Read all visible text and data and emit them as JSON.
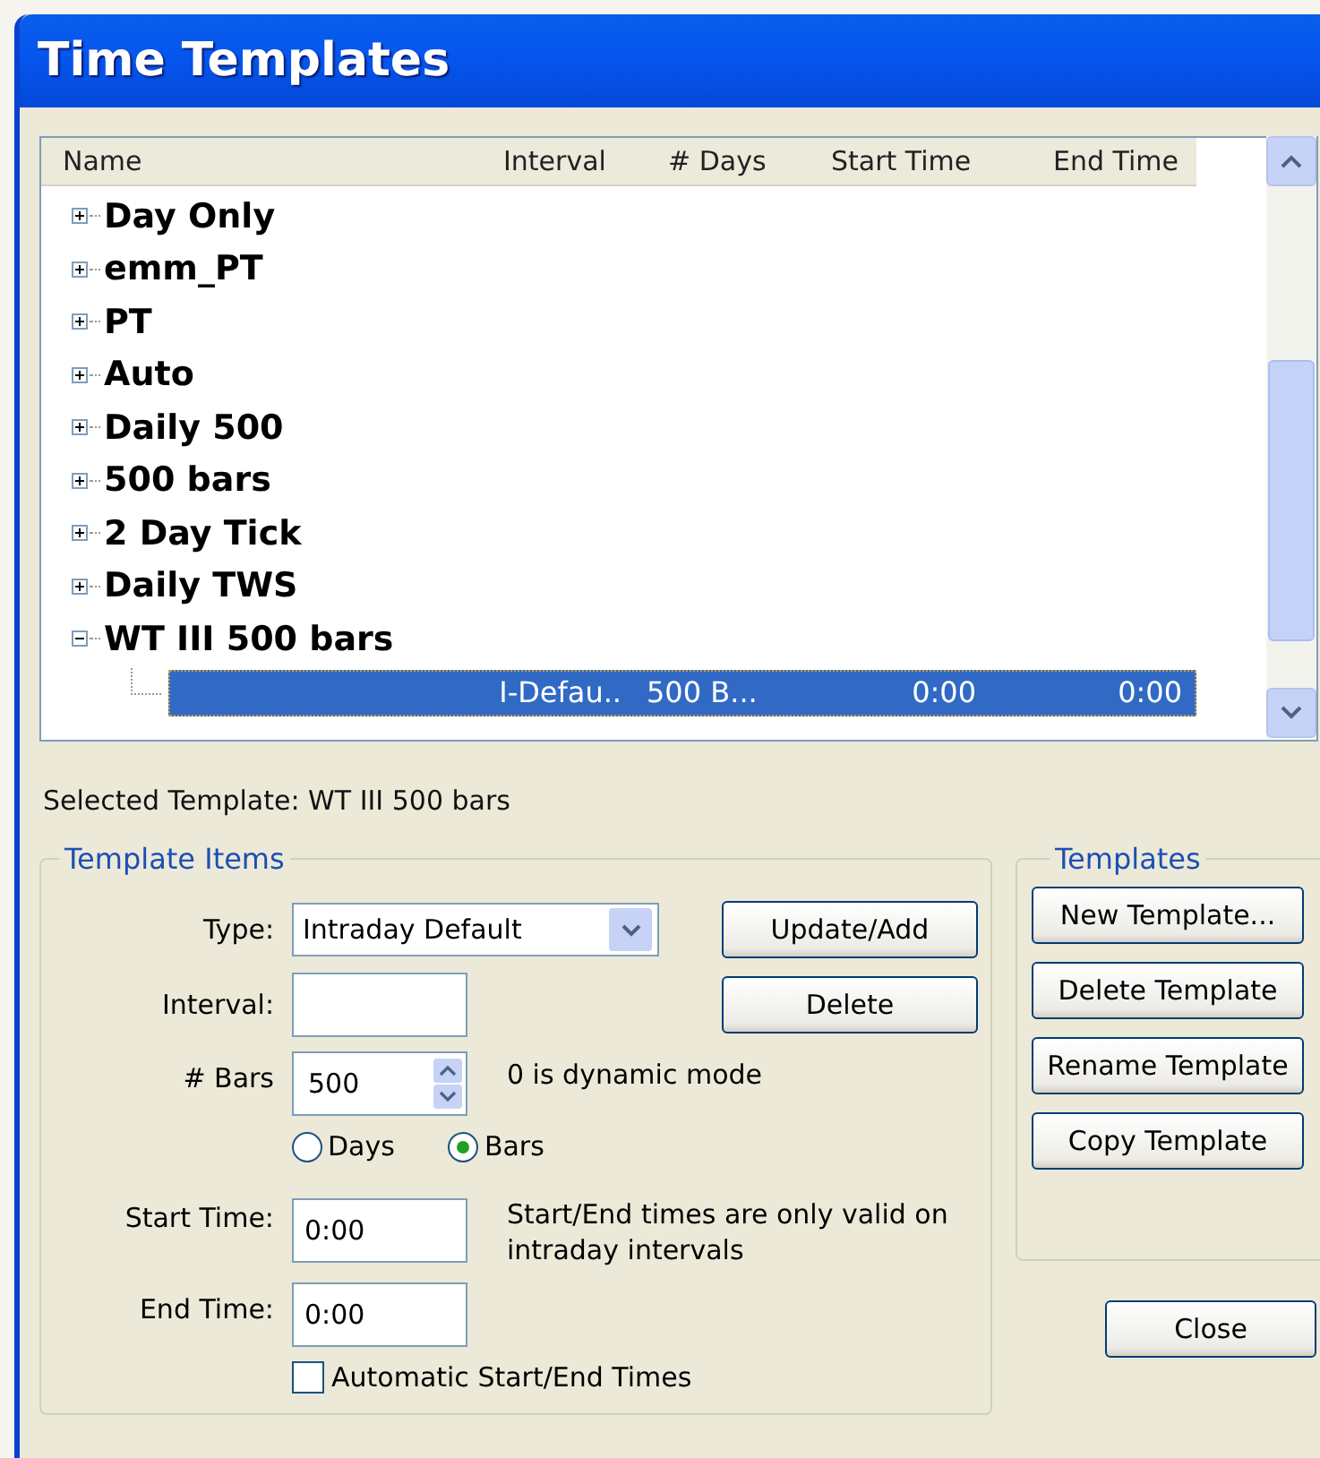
{
  "window": {
    "title": "Time Templates"
  },
  "tree": {
    "columns": [
      "Name",
      "Interval",
      "# Days",
      "Start Time",
      "End Time"
    ],
    "items": [
      {
        "name": "Day Only",
        "expanded": false
      },
      {
        "name": "emm_PT",
        "expanded": false
      },
      {
        "name": "PT",
        "expanded": false
      },
      {
        "name": "Auto",
        "expanded": false
      },
      {
        "name": "Daily 500",
        "expanded": false
      },
      {
        "name": "500 bars",
        "expanded": false
      },
      {
        "name": "2 Day Tick",
        "expanded": false
      },
      {
        "name": "Daily TWS",
        "expanded": false
      },
      {
        "name": "WT III 500 bars",
        "expanded": true,
        "children": [
          {
            "interval": "I-Defau..",
            "days": "500 B...",
            "start_time": "0:00",
            "end_time": "0:00",
            "selected": true
          }
        ]
      }
    ]
  },
  "selected_template": "Selected Template: WT III 500 bars",
  "template_items": {
    "title": "Template Items",
    "type": {
      "label": "Type:",
      "value": "Intraday Default"
    },
    "interval": {
      "label": "Interval:"
    },
    "bars": {
      "label": "# Bars",
      "value": "500",
      "hint": "0 is dynamic mode"
    },
    "radios": [
      {
        "label": "Days",
        "selected": false
      },
      {
        "label": "Bars",
        "selected": true
      }
    ],
    "start_time": {
      "label": "Start Time:",
      "value": "0:00",
      "hint": "Start/End times are only valid on intraday intervals"
    },
    "end_time": {
      "label": "End Time:",
      "value": "0:00"
    },
    "auto_times": {
      "label": "Automatic Start/End Times",
      "checked": false
    },
    "buttons": [
      "Update/Add",
      "Delete"
    ]
  },
  "templates": {
    "title": "Templates",
    "buttons": [
      "New Template...",
      "Delete Template",
      "Rename Template",
      "Copy Template"
    ]
  },
  "close_button": "Close"
}
